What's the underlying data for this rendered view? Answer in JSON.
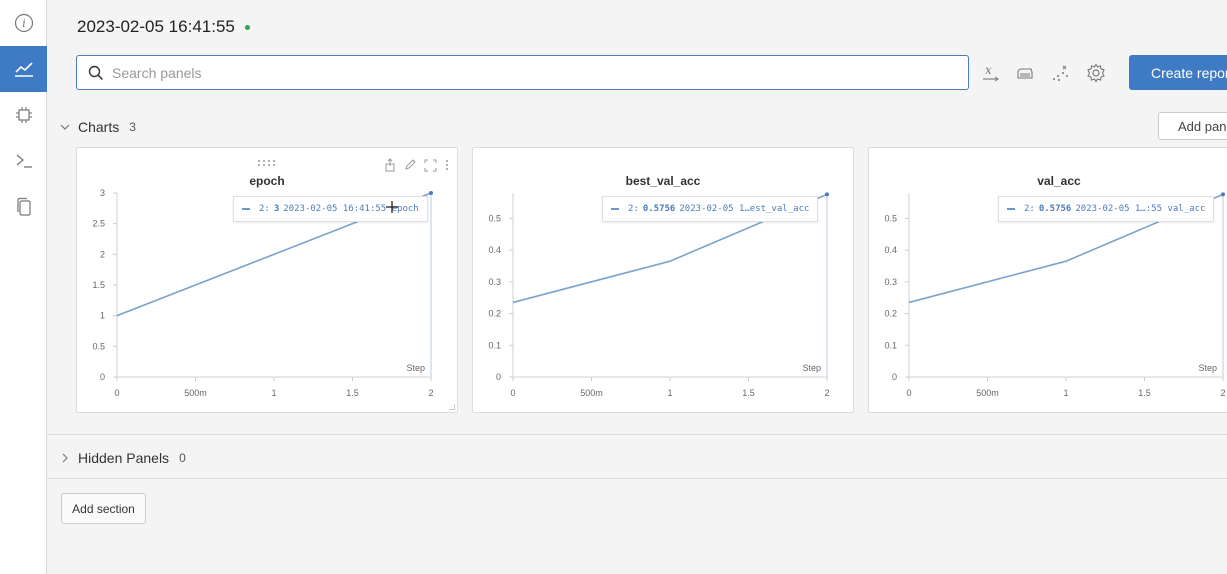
{
  "sidebar": {
    "items": [
      {
        "icon": "info-icon",
        "active": false
      },
      {
        "icon": "chart-icon",
        "active": true
      },
      {
        "icon": "chip-icon",
        "active": false
      },
      {
        "icon": "terminal-icon",
        "active": false
      },
      {
        "icon": "files-icon",
        "active": false
      }
    ]
  },
  "header": {
    "run_name": "2023-02-05 16:41:55",
    "status_color": "#2ea44f"
  },
  "search": {
    "placeholder": "Search panels",
    "value": ""
  },
  "toolbar": {
    "icons": [
      "x-axis-icon",
      "smoothing-icon",
      "outliers-icon",
      "settings-icon"
    ],
    "create_report_label": "Create report"
  },
  "charts_section": {
    "label": "Charts",
    "count": "3",
    "add_panel_label": "Add panel"
  },
  "hidden_section": {
    "label": "Hidden Panels",
    "count": "0"
  },
  "add_section_label": "Add section",
  "accent_color": "#3e7bc4",
  "line_color": "#7aa3cc",
  "panels": [
    {
      "title": "epoch",
      "tooltip": {
        "prefix": "2:",
        "value": "3",
        "rest": "2023-02-05 16:41:55 epoch"
      },
      "step_label": "Step"
    },
    {
      "title": "best_val_acc",
      "tooltip": {
        "prefix": "2:",
        "value": "0.5756",
        "rest": "2023-02-05 1…est_val_acc"
      },
      "step_label": "Step"
    },
    {
      "title": "val_acc",
      "tooltip": {
        "prefix": "2:",
        "value": "0.5756",
        "rest": "2023-02-05 1…:55 val_acc"
      },
      "step_label": "Step"
    }
  ],
  "chart_data": [
    {
      "type": "line",
      "title": "epoch",
      "xlabel": "Step",
      "x": [
        0,
        1,
        2
      ],
      "series": [
        {
          "values": [
            1,
            2,
            3
          ]
        }
      ],
      "xticks": [
        "0",
        "500m",
        "1",
        "1.5",
        "2"
      ],
      "yticks": [
        "0",
        "0.5",
        "1",
        "1.5",
        "2",
        "2.5",
        "3"
      ],
      "xlim": [
        0,
        2
      ],
      "ylim": [
        0,
        3
      ]
    },
    {
      "type": "line",
      "title": "best_val_acc",
      "xlabel": "Step",
      "x": [
        0,
        1,
        2
      ],
      "series": [
        {
          "values": [
            0.235,
            0.365,
            0.5756
          ]
        }
      ],
      "xticks": [
        "0",
        "500m",
        "1",
        "1.5",
        "2"
      ],
      "yticks": [
        "0",
        "0.1",
        "0.2",
        "0.3",
        "0.4",
        "0.5"
      ],
      "xlim": [
        0,
        2
      ],
      "ylim": [
        0,
        0.58
      ]
    },
    {
      "type": "line",
      "title": "val_acc",
      "xlabel": "Step",
      "x": [
        0,
        1,
        2
      ],
      "series": [
        {
          "values": [
            0.235,
            0.365,
            0.5756
          ]
        }
      ],
      "xticks": [
        "0",
        "500m",
        "1",
        "1.5",
        "2"
      ],
      "yticks": [
        "0",
        "0.1",
        "0.2",
        "0.3",
        "0.4",
        "0.5"
      ],
      "xlim": [
        0,
        2
      ],
      "ylim": [
        0,
        0.58
      ]
    }
  ]
}
